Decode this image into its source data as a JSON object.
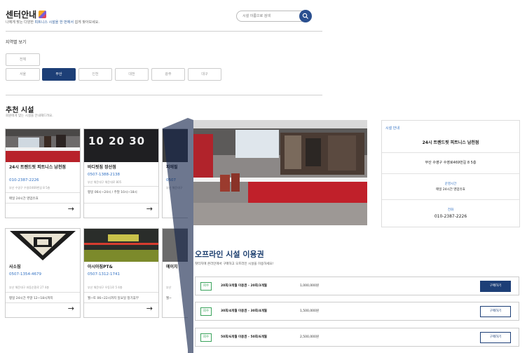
{
  "header": {
    "title": "센터안내",
    "subtitle_pre": "나에게 맞는 다양한",
    "subtitle_hl": "피트니스 시설을 한 번에서",
    "subtitle_post": "쉽게 찾아보세요.",
    "search_placeholder": "시설 이름으로 검색"
  },
  "region": {
    "label": "지역별 보기",
    "all_label": "전체",
    "buttons": [
      "서울",
      "부산",
      "인천",
      "대전",
      "광주",
      "대구"
    ],
    "active": "부산"
  },
  "recommended": {
    "title": "추천 시설",
    "subtitle": "회원에게 맞는 시설을 안내해드려요.",
    "cards": [
      {
        "name": "24시 트렌드핏 피트니스 남천점",
        "phone": "010-2387-2226",
        "addr": "부산 수영구 수영로469번길 8 5층",
        "hours": "매일 24시간 영업유효"
      },
      {
        "name": "바디핏짐 장산점",
        "phone": "0507-1388-2138",
        "addr": "부산 해운대구 해운대로 805",
        "hours": "평일 06시~24시 / 주말 10시~18시"
      },
      {
        "name": "피에필",
        "phone": "0507",
        "addr": "부산 해운대구",
        "hours": ""
      },
      {
        "name": "사소짐",
        "phone": "0507-1354-4679",
        "addr": "부산 해운대구 좌동순환로 27 4층",
        "hours": "평일 24시간 주말 12~18시까지"
      },
      {
        "name": "아시아짐PT&",
        "phone": "0507-1312-1741",
        "addr": "부산 해운대구 우동1로 5 4층",
        "hours": "월~토 06~22시까지 일요일 정기휴무"
      },
      {
        "name": "에이치",
        "phone": "",
        "addr": "부산",
        "hours": "월~"
      }
    ],
    "card3_text": "10 20 30"
  },
  "detail": {
    "category": "시설 안내",
    "name": "24시 트렌드핏 피트니스 남천점",
    "address": "부산 수영구 수영로469번길 8 5층",
    "hours_label": "운영시간",
    "hours": "매일 24시간 영업유효",
    "phone_label": "전화",
    "phone": "010-2387-2226"
  },
  "offline": {
    "title": "오프라인 시설 이용권",
    "subtitle": "핏터치에 온라인에서 구매하고 오프라인 시설을 이용하세요!",
    "tickets": [
      {
        "tag": "회수",
        "name": "20회/3개월 이용권 - 20회/3개월",
        "price": "1,000,000원",
        "buy": "구매하기"
      },
      {
        "tag": "회수",
        "name": "30회/4개월 이용권 - 30회/4개월",
        "price": "1,500,000원",
        "buy": "구매하기"
      },
      {
        "tag": "회수",
        "name": "50회/6개월 이용권 - 50회/6개월",
        "price": "2,500,000원",
        "buy": "구매하기"
      }
    ]
  },
  "colors": {
    "primary": "#1d3f77",
    "accent": "#2f6fc2",
    "tag_green": "#3aa35b"
  }
}
